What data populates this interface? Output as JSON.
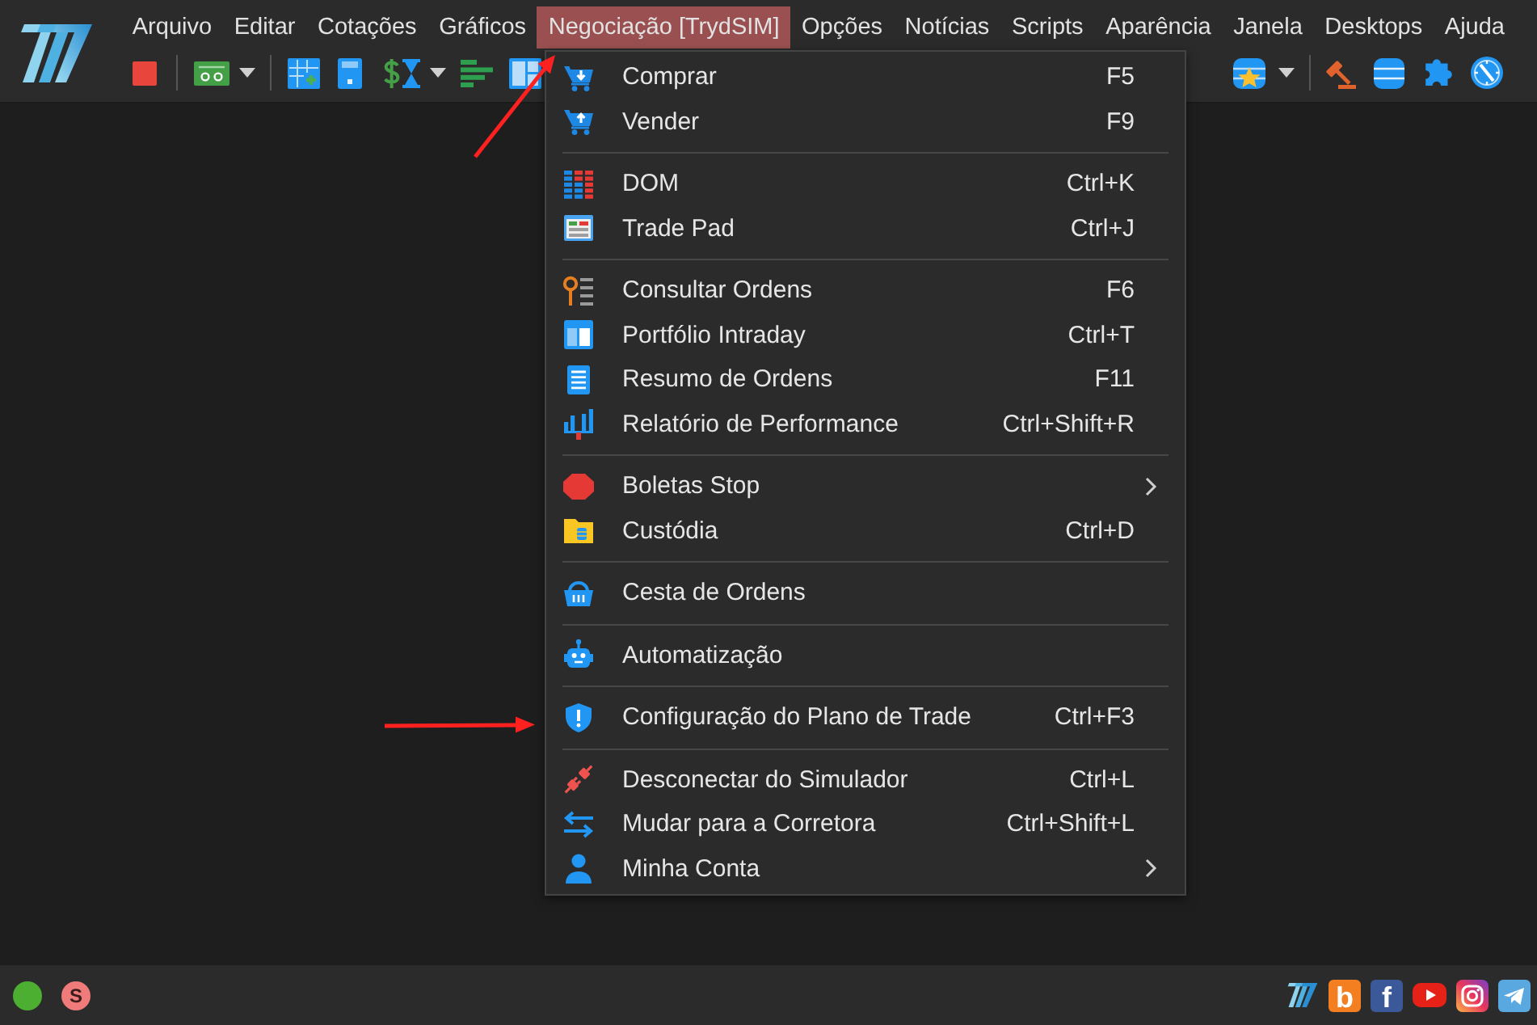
{
  "menubar": {
    "items": [
      {
        "label": "Arquivo",
        "selected": false
      },
      {
        "label": "Editar",
        "selected": false
      },
      {
        "label": "Cotações",
        "selected": false
      },
      {
        "label": "Gráficos",
        "selected": false
      },
      {
        "label": "Negociação [TrydSIM]",
        "selected": true
      },
      {
        "label": "Opções",
        "selected": false
      },
      {
        "label": "Notícias",
        "selected": false
      },
      {
        "label": "Scripts",
        "selected": false
      },
      {
        "label": "Aparência",
        "selected": false
      },
      {
        "label": "Janela",
        "selected": false
      },
      {
        "label": "Desktops",
        "selected": false
      },
      {
        "label": "Ajuda",
        "selected": false
      }
    ]
  },
  "trading_menu": {
    "groups": [
      {
        "items": [
          {
            "label": "Comprar",
            "shortcut": "F5",
            "submenu": false
          },
          {
            "label": "Vender",
            "shortcut": "F9",
            "submenu": false
          }
        ]
      },
      {
        "items": [
          {
            "label": "DOM",
            "shortcut": "Ctrl+K",
            "submenu": false
          },
          {
            "label": "Trade Pad",
            "shortcut": "Ctrl+J",
            "submenu": false
          }
        ]
      },
      {
        "items": [
          {
            "label": "Consultar Ordens",
            "shortcut": "F6",
            "submenu": false
          },
          {
            "label": "Portfólio Intraday",
            "shortcut": "Ctrl+T",
            "submenu": false
          },
          {
            "label": "Resumo de Ordens",
            "shortcut": "F11",
            "submenu": false
          },
          {
            "label": "Relatório de Performance",
            "shortcut": "Ctrl+Shift+R",
            "submenu": false
          }
        ]
      },
      {
        "items": [
          {
            "label": "Boletas Stop",
            "submenu": true
          },
          {
            "label": "Custódia",
            "shortcut": "Ctrl+D",
            "submenu": false
          }
        ]
      },
      {
        "items": [
          {
            "label": "Cesta de Ordens",
            "submenu": false
          }
        ]
      },
      {
        "items": [
          {
            "label": "Automatização",
            "submenu": false
          }
        ]
      },
      {
        "items": [
          {
            "label": "Configuração do Plano de Trade",
            "shortcut": "Ctrl+F3",
            "submenu": false
          }
        ]
      },
      {
        "items": [
          {
            "label": "Desconectar do Simulador",
            "shortcut": "Ctrl+L",
            "submenu": false
          },
          {
            "label": "Mudar para a Corretora",
            "shortcut": "Ctrl+Shift+L",
            "submenu": false
          },
          {
            "label": "Minha Conta",
            "submenu": true
          }
        ]
      }
    ]
  },
  "status_bar": {
    "connected": true,
    "badge": "S",
    "links": [
      {
        "kind": "logo"
      },
      {
        "kind": "blog",
        "glyph": "b"
      },
      {
        "kind": "facebook",
        "glyph": "f"
      },
      {
        "kind": "youtube"
      },
      {
        "kind": "instagram"
      },
      {
        "kind": "telegram"
      }
    ]
  }
}
